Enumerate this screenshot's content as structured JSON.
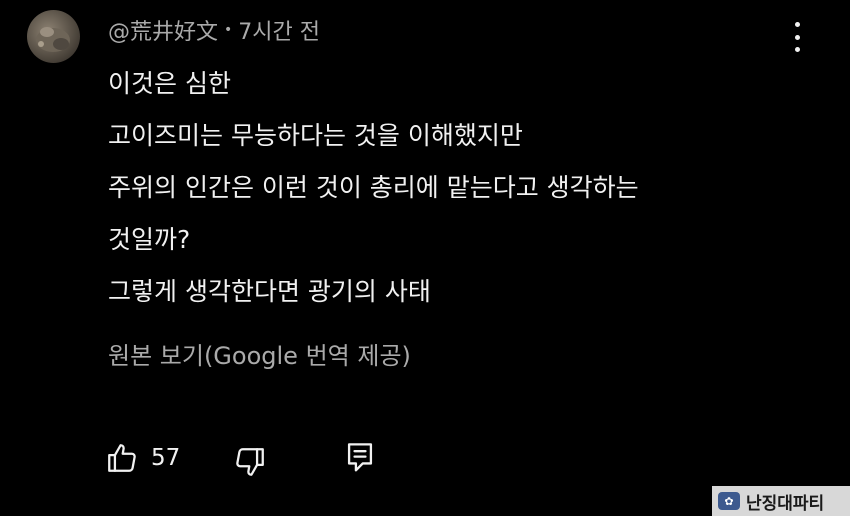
{
  "comment": {
    "author": "@荒井好文",
    "separator": "•",
    "time": "7시간 전",
    "lines": [
      "이것은 심한",
      "고이즈미는 무능하다는 것을 이해했지만",
      "주위의 인간은 이런 것이 총리에 맡는다고 생각하는",
      "것일까?",
      "그렇게 생각한다면 광기의 사태"
    ],
    "translate_link": "원본 보기(Google 번역 제공)",
    "like_count": "57"
  },
  "icons": {
    "avatar": "user-avatar",
    "menu": "more-vert-icon",
    "like": "thumb-up-icon",
    "dislike": "thumb-down-icon",
    "reply": "reply-comment-icon"
  },
  "watermark": {
    "text": "난징대파티"
  }
}
